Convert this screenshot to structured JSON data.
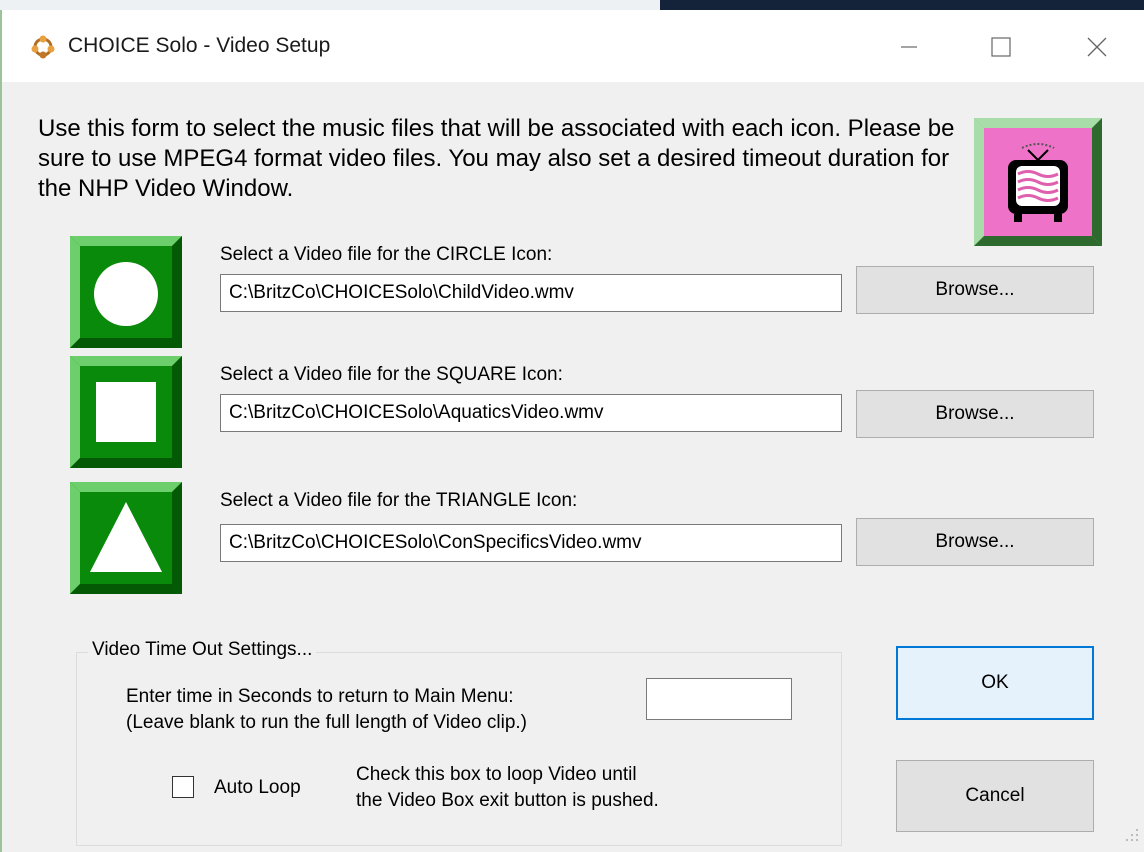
{
  "window": {
    "title": "CHOICE Solo - Video Setup",
    "minimize_icon": "minimize-icon",
    "maximize_icon": "maximize-icon",
    "close_icon": "close-icon"
  },
  "instructions": "Use this form to select the music files that will be associated with each icon.  Please be sure to use MPEG4 format video files.  You may also set a desired timeout duration for the NHP Video Window.",
  "video_files": [
    {
      "shape": "circle",
      "label": "Select a Video file for the CIRCLE Icon:",
      "value": "C:\\BritzCo\\CHOICESolo\\ChildVideo.wmv",
      "browse_label": "Browse..."
    },
    {
      "shape": "square",
      "label": "Select a Video file for the SQUARE Icon:",
      "value": "C:\\BritzCo\\CHOICESolo\\AquaticsVideo.wmv",
      "browse_label": "Browse..."
    },
    {
      "shape": "triangle",
      "label": "Select a Video file for the TRIANGLE Icon:",
      "value": "C:\\BritzCo\\CHOICESolo\\ConSpecificsVideo.wmv",
      "browse_label": "Browse..."
    }
  ],
  "timeout": {
    "group_title": "Video Time Out Settings...",
    "line1": "Enter time in Seconds to return to Main Menu:",
    "line2": "(Leave blank to run the full length of Video clip.)",
    "value": ""
  },
  "auto_loop": {
    "label": "Auto Loop",
    "checked": false,
    "help_line1": "Check this box to loop Video until",
    "help_line2": "the Video Box exit button is pushed."
  },
  "buttons": {
    "ok": "OK",
    "cancel": "Cancel"
  },
  "colors": {
    "shape_green": "#0a8a0a",
    "tv_pink": "#ee72c8",
    "accent_blue": "#0078d7"
  }
}
